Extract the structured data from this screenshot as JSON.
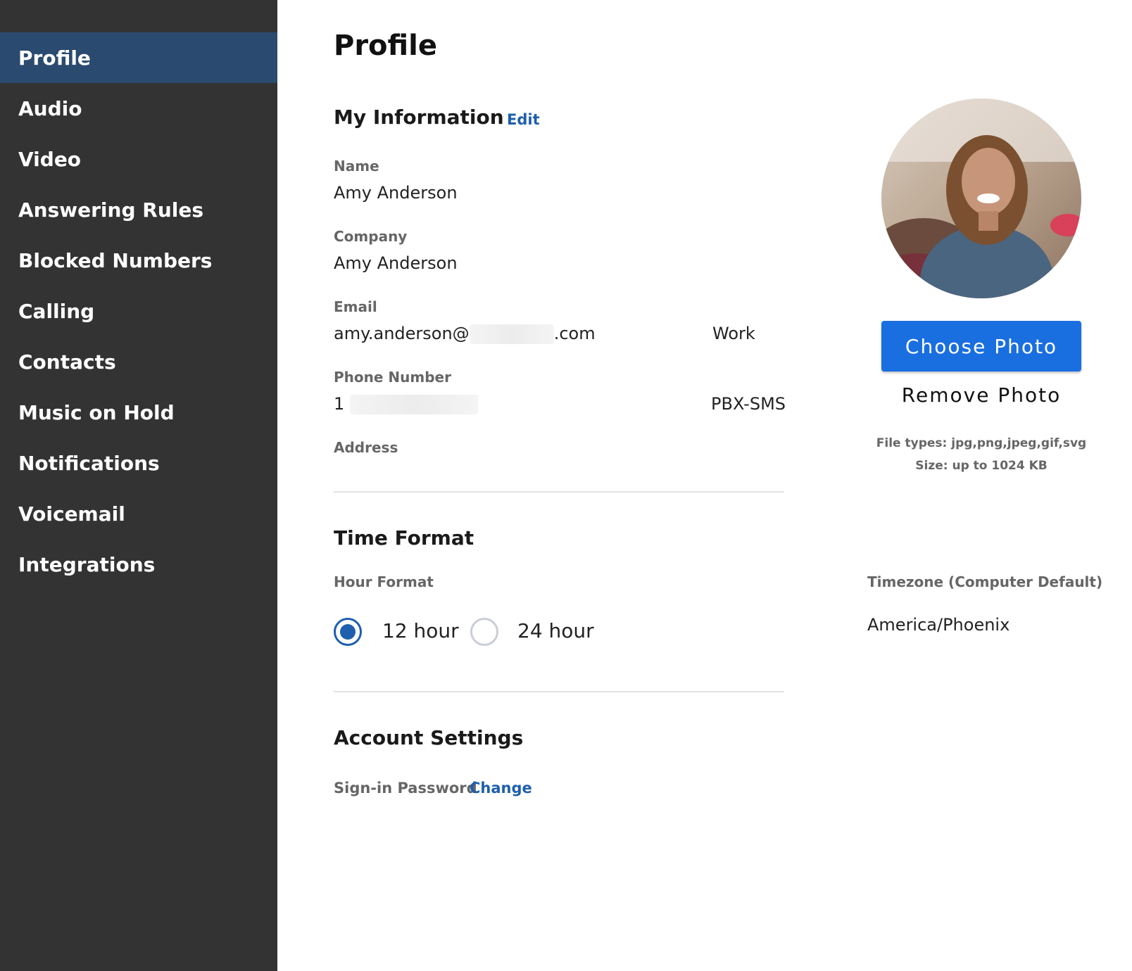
{
  "sidebar": {
    "items": [
      {
        "label": "Profile",
        "active": true
      },
      {
        "label": "Audio"
      },
      {
        "label": "Video"
      },
      {
        "label": "Answering Rules"
      },
      {
        "label": "Blocked Numbers"
      },
      {
        "label": "Calling"
      },
      {
        "label": "Contacts"
      },
      {
        "label": "Music on Hold"
      },
      {
        "label": "Notifications"
      },
      {
        "label": "Voicemail"
      },
      {
        "label": "Integrations"
      }
    ]
  },
  "page": {
    "title": "Profile"
  },
  "my_information": {
    "title": "My Information",
    "edit_label": "Edit",
    "name_label": "Name",
    "name_value": "Amy Anderson",
    "company_label": "Company",
    "company_value": "Amy Anderson",
    "email_label": "Email",
    "email_prefix": "amy.anderson@",
    "email_suffix": ".com",
    "email_type": "Work",
    "phone_label": "Phone Number",
    "phone_prefix": "1",
    "phone_type": "PBX-SMS",
    "address_label": "Address"
  },
  "photo": {
    "choose_label": "Choose Photo",
    "remove_label": "Remove Photo",
    "file_types": "File types: jpg,png,jpeg,gif,svg",
    "size_limit": "Size: up to 1024 KB"
  },
  "time_format": {
    "title": "Time Format",
    "hour_format_label": "Hour Format",
    "option_12": "12 hour",
    "option_24": "24 hour",
    "selected": "12 hour",
    "timezone_label": "Timezone (Computer Default)",
    "timezone_value": "America/Phoenix"
  },
  "account_settings": {
    "title": "Account Settings",
    "password_label": "Sign-in Password",
    "change_label": "Change"
  },
  "colors": {
    "sidebar_bg": "#333333",
    "sidebar_active": "#2b4a6f",
    "accent_link": "#1e5fae",
    "primary_button": "#1a6fe0"
  }
}
